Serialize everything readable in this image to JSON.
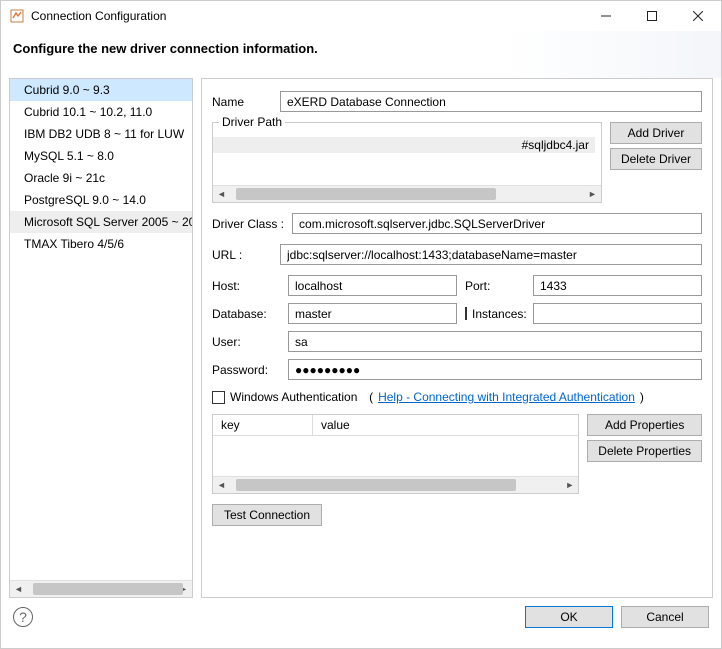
{
  "window": {
    "title": "Connection Configuration",
    "subtitle": "Configure the new driver connection information."
  },
  "sidebar": {
    "items": [
      {
        "label": "Cubrid 9.0 ~ 9.3",
        "selected": true
      },
      {
        "label": "Cubrid 10.1 ~ 10.2, 11.0"
      },
      {
        "label": "IBM DB2 UDB 8 ~ 11 for LUW"
      },
      {
        "label": "MySQL 5.1 ~ 8.0"
      },
      {
        "label": "Oracle 9i ~ 21c"
      },
      {
        "label": "PostgreSQL 9.0 ~ 14.0"
      },
      {
        "label": "Microsoft SQL Server 2005 ~ 20",
        "highlighted": true
      },
      {
        "label": "TMAX Tibero 4/5/6"
      }
    ]
  },
  "form": {
    "name_label": "Name",
    "name_value": "eXERD Database Connection",
    "driver_path_label": "Driver Path",
    "driver_items": [
      "#sqljdbc4.jar"
    ],
    "add_driver": "Add Driver",
    "delete_driver": "Delete Driver",
    "driver_class_label": "Driver Class :",
    "driver_class_value": "com.microsoft.sqlserver.jdbc.SQLServerDriver",
    "url_label": "URL :",
    "url_value": "jdbc:sqlserver://localhost:1433;databaseName=master",
    "host_label": "Host:",
    "host_value": "localhost",
    "port_label": "Port:",
    "port_value": "1433",
    "database_label": "Database:",
    "database_value": "master",
    "instances_label": "Instances:",
    "instances_value": "",
    "user_label": "User:",
    "user_value": "sa",
    "password_label": "Password:",
    "password_value": "●●●●●●●●●",
    "winauth_label": "Windows Authentication",
    "help_link": "Help - Connecting with Integrated Authentication",
    "key_header": "key",
    "value_header": "value",
    "add_properties": "Add Properties",
    "delete_properties": "Delete Properties",
    "test_connection": "Test Connection"
  },
  "footer": {
    "ok": "OK",
    "cancel": "Cancel"
  }
}
